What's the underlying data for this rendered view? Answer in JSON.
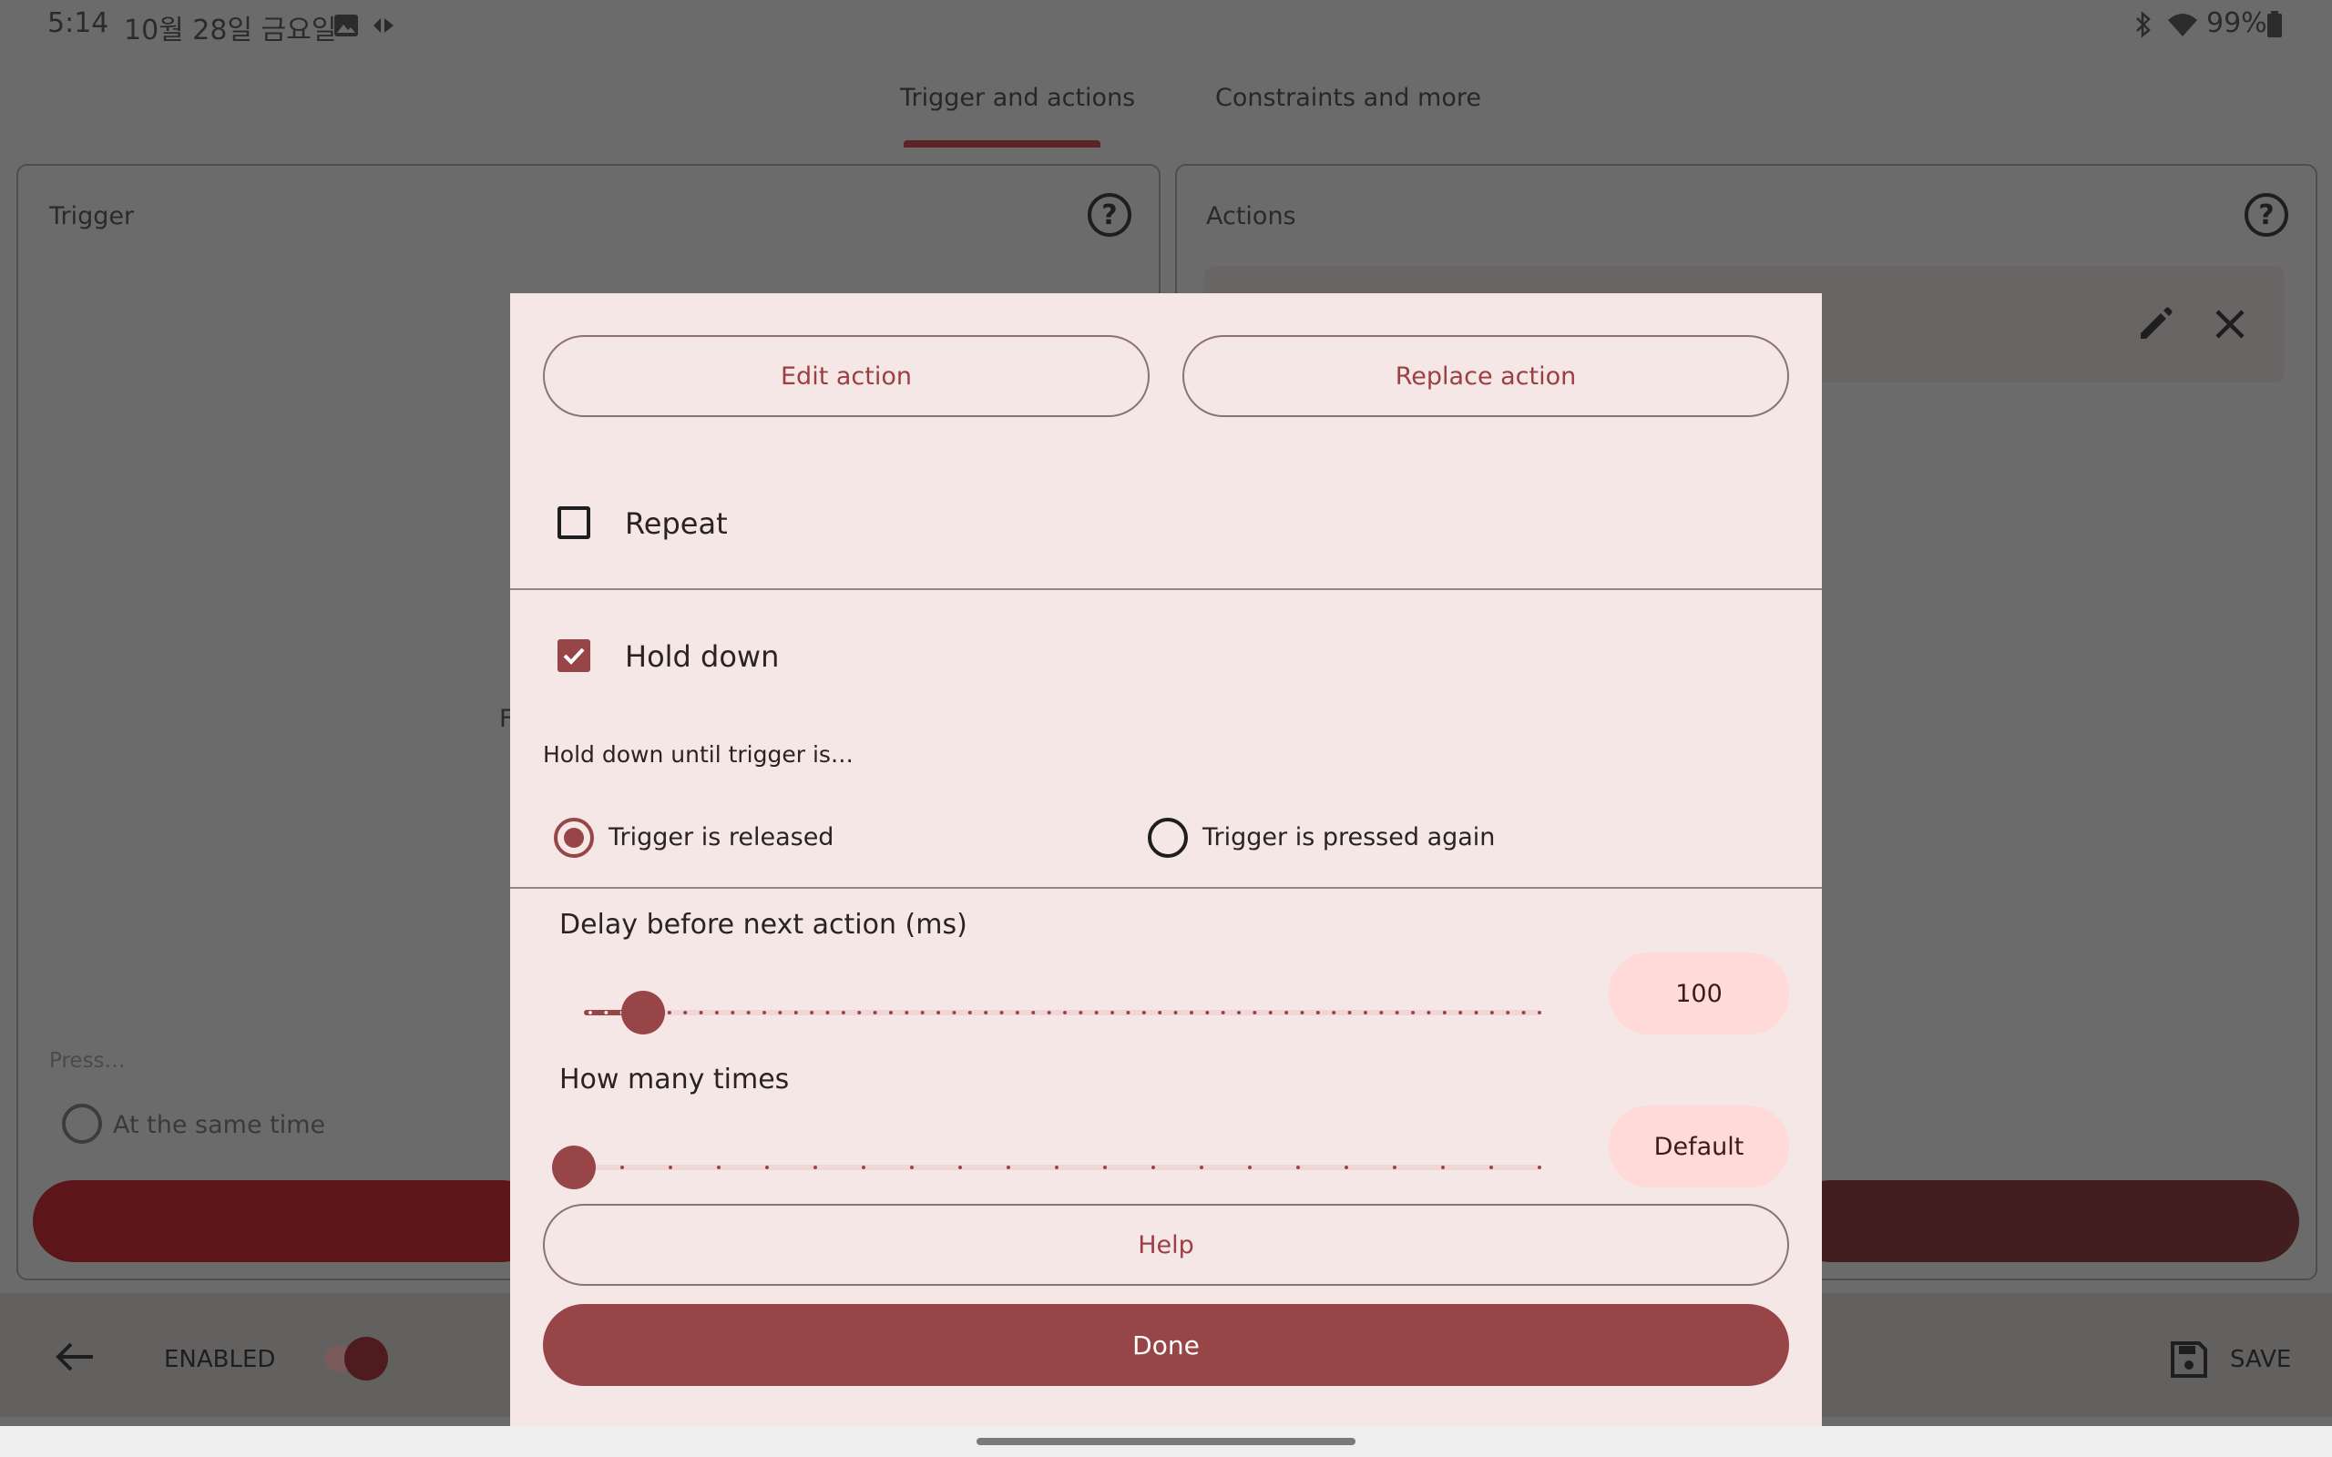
{
  "status_bar": {
    "time": "5:14",
    "date": "10월 28일 금요일",
    "battery": "99%"
  },
  "tabs": [
    {
      "label": "Trigger and actions",
      "selected": true
    },
    {
      "label": "Constraints and more",
      "selected": false
    }
  ],
  "trigger_panel": {
    "title": "Trigger",
    "partial_text": "F",
    "press_label": "Press…",
    "mode_option": "At the same time"
  },
  "actions_panel": {
    "title": "Actions"
  },
  "bottom_bar": {
    "enabled_label": "ENABLED",
    "save_label": "SAVE"
  },
  "dialog": {
    "edit_action_label": "Edit action",
    "replace_action_label": "Replace action",
    "repeat": {
      "label": "Repeat",
      "checked": false
    },
    "hold_down": {
      "label": "Hold down",
      "checked": true
    },
    "hold_until_label": "Hold down until trigger is…",
    "radio_options": [
      {
        "label": "Trigger is released",
        "selected": true
      },
      {
        "label": "Trigger is pressed again",
        "selected": false
      }
    ],
    "delay": {
      "label": "Delay before next action (ms)",
      "value": "100",
      "slider_fraction": 0.056
    },
    "how_many": {
      "label": "How many times",
      "value": "Default",
      "slider_fraction": 0.0
    },
    "help_label": "Help",
    "done_label": "Done"
  },
  "colors": {
    "accent": "#984548",
    "dialog_bg": "#f5e7e6",
    "value_pill_bg": "#ffdad8",
    "scrim": "#6b6b6b"
  },
  "icons": [
    "image-icon",
    "dev-tools-icon",
    "bluetooth-icon",
    "wifi-icon",
    "battery-icon",
    "help-icon",
    "edit-icon",
    "close-icon",
    "back-arrow-icon",
    "save-icon"
  ]
}
